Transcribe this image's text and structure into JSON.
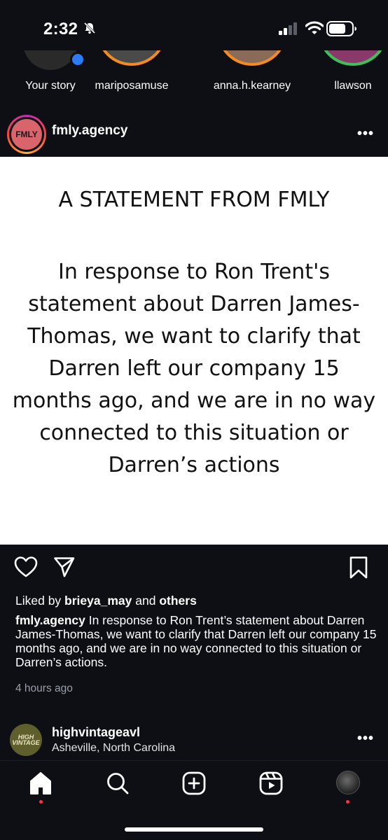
{
  "status": {
    "time": "2:32"
  },
  "stories": [
    {
      "name": "Your story",
      "ring": "none"
    },
    {
      "name": "mariposamuse",
      "ring": "#f28b21"
    },
    {
      "name": "anna.h.kearney",
      "ring": "#f28b21"
    },
    {
      "name": "llawson",
      "ring": "#3fbf5b"
    }
  ],
  "post": {
    "username": "fmly.agency",
    "avatar_text": "FMLY",
    "image_title": "A STATEMENT FROM FMLY",
    "image_body": "In response to Ron Trent's statement about Darren James-Thomas, we want to clarify that Darren left our company 15 months ago, and we are in no way connected to this situation or Darren’s actions",
    "liked_prefix": "Liked by ",
    "liked_user": "brieya_may",
    "liked_and": " and ",
    "liked_others": "others",
    "caption_user": "fmly.agency",
    "caption_text": " In response to Ron Trent’s statement about Darren James-Thomas, we want to clarify that Darren left our company 15 months ago, and we are in no way connected to this situation or Darren’s actions.",
    "time_ago": "4 hours ago"
  },
  "next_post": {
    "username": "highvintageavl",
    "location": "Asheville, North Carolina",
    "avatar_text": "HIGH VINTAGE"
  },
  "icons": {
    "like": "heart-icon",
    "share": "send-icon",
    "save": "bookmark-icon",
    "home": "home-icon",
    "search": "search-icon",
    "create": "plus-square-icon",
    "reels": "reels-icon"
  },
  "colors": {
    "background": "#0d0f15",
    "notification_dot": "#ff3040"
  }
}
